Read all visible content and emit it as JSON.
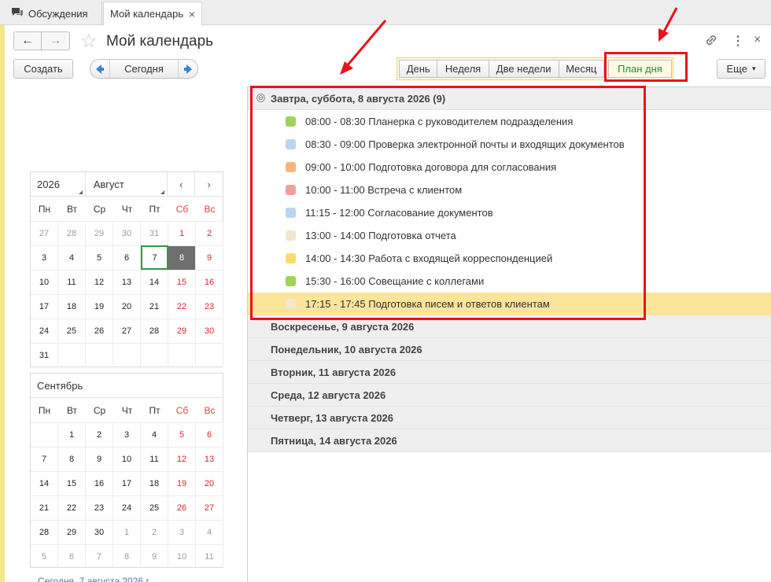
{
  "tabs": [
    {
      "label": "Обсуждения",
      "icon": "chat-bubbles-icon"
    },
    {
      "label": "Мой календарь",
      "close": "×"
    }
  ],
  "header": {
    "title": "Мой календарь",
    "back": "←",
    "forward": "→",
    "star": "☆",
    "link": "🔗",
    "more": "⋮",
    "close": "×"
  },
  "toolbar": {
    "create": "Создать",
    "today": "Сегодня",
    "more": "Еще",
    "more_caret": "▾"
  },
  "modes": [
    "День",
    "Неделя",
    "Две недели",
    "Месяц",
    "План дня"
  ],
  "active_mode": "План дня",
  "weekdays": [
    "Пн",
    "Вт",
    "Ср",
    "Чт",
    "Пт",
    "Сб",
    "Вс"
  ],
  "calendar_august": {
    "year": "2026",
    "month": "Август",
    "prev": "‹",
    "next": "›",
    "weeks": [
      [
        "27",
        "28",
        "29",
        "30",
        "31",
        "1",
        "2"
      ],
      [
        "3",
        "4",
        "5",
        "6",
        "7",
        "8",
        "9"
      ],
      [
        "10",
        "11",
        "12",
        "13",
        "14",
        "15",
        "16"
      ],
      [
        "17",
        "18",
        "19",
        "20",
        "21",
        "22",
        "23"
      ],
      [
        "24",
        "25",
        "26",
        "27",
        "28",
        "29",
        "30"
      ],
      [
        "31",
        "",
        "",
        "",
        "",
        "",
        ""
      ]
    ],
    "today": "7",
    "selected": "8"
  },
  "calendar_september": {
    "month": "Сентябрь",
    "weeks": [
      [
        "",
        "1",
        "2",
        "3",
        "4",
        "5",
        "6"
      ],
      [
        "7",
        "8",
        "9",
        "10",
        "11",
        "12",
        "13"
      ],
      [
        "14",
        "15",
        "16",
        "17",
        "18",
        "19",
        "20"
      ],
      [
        "21",
        "22",
        "23",
        "24",
        "25",
        "26",
        "27"
      ],
      [
        "28",
        "29",
        "30",
        "1",
        "2",
        "3",
        "4"
      ],
      [
        "5",
        "6",
        "7",
        "8",
        "9",
        "10",
        "11"
      ]
    ]
  },
  "footer_link": "Сегодня, 7 августа 2026 г.",
  "plan": {
    "expanded_day": "Завтра, суббота, 8 августа 2026 (9)",
    "toggle": "⊖",
    "events": [
      {
        "text": "08:00 - 08:30 Планерка с руководителем подразделения",
        "color": "#9ed35a"
      },
      {
        "text": "08:30 - 09:00 Проверка электронной почты и входящих документов",
        "color": "#b9d5f2"
      },
      {
        "text": "09:00 - 10:00 Подготовка договора для согласования",
        "color": "#f9b47d"
      },
      {
        "text": "10:00 - 11:00 Встреча с клиентом",
        "color": "#f49c9c"
      },
      {
        "text": "11:15 - 12:00 Согласование документов",
        "color": "#b9d5f2"
      },
      {
        "text": "13:00 - 14:00 Подготовка отчета",
        "color": "#f5e6cf"
      },
      {
        "text": "14:00 - 14:30 Работа с входящей корреспонденцией",
        "color": "#fbdc6c"
      },
      {
        "text": "15:30 - 16:00 Совещание с коллегами",
        "color": "#9ed35a"
      },
      {
        "text": "17:15 - 17:45 Подготовка писем и ответов клиентам",
        "color": "#f5e6cf"
      }
    ],
    "collapsed_days": [
      "Воскресенье, 9 августа 2026",
      "Понедельник, 10 августа 2026",
      "Вторник, 11 августа 2026",
      "Среда, 12 августа 2026",
      "Четверг, 13 августа 2026",
      "Пятница, 14 августа 2026"
    ]
  },
  "colors": {
    "annotation": "#e8141b",
    "active_mode_text": "#1a8a3a",
    "weekend": "#d7262c",
    "selection": "#fbe59b"
  }
}
